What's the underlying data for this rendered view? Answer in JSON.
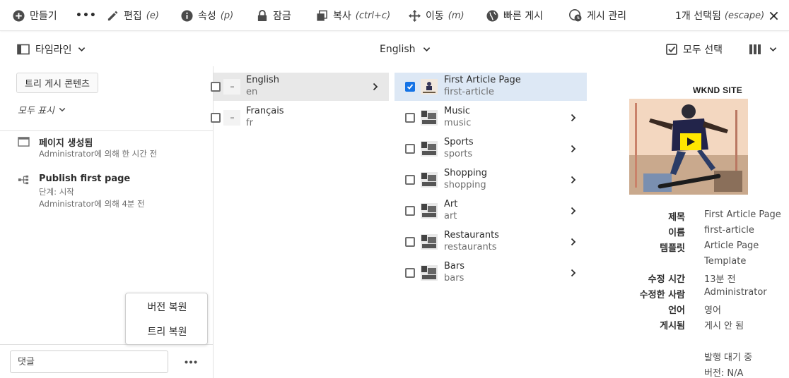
{
  "actionbar": {
    "create": "만들기",
    "more": "•••",
    "edit": "편집",
    "edit_shortcut": "(e)",
    "properties": "속성",
    "properties_shortcut": "(p)",
    "lock": "잠금",
    "copy": "복사",
    "copy_shortcut": "(ctrl+c)",
    "move": "이동",
    "move_shortcut": "(m)",
    "quick_publish": "빠른 게시",
    "manage_publication": "게시 관리",
    "selection_count": "1개 선택됨",
    "selection_shortcut": "(escape)"
  },
  "toolbar2": {
    "rail_selector": "타임라인",
    "language": "English",
    "select_all": "모두 선택"
  },
  "rail": {
    "tree_button": "트리 게시 콘텐츠",
    "filter": "모두 표시",
    "timeline": [
      {
        "title": "페이지 생성됨",
        "lines": [
          "Administrator에 의해 한 시간 전"
        ]
      },
      {
        "title": "Publish first page",
        "lines": [
          "단계: 시작",
          "Administrator에 의해 4분 전"
        ]
      }
    ],
    "popover": {
      "restore_version": "버전 복원",
      "restore_tree": "트리 복원"
    },
    "comment_placeholder": "댓글",
    "more": "•••"
  },
  "column1": {
    "items": [
      {
        "title": "English",
        "name": "en"
      },
      {
        "title": "Français",
        "name": "fr"
      }
    ]
  },
  "column2": {
    "items": [
      {
        "title": "First Article Page",
        "name": "first-article"
      },
      {
        "title": "Music",
        "name": "music"
      },
      {
        "title": "Sports",
        "name": "sports"
      },
      {
        "title": "Shopping",
        "name": "shopping"
      },
      {
        "title": "Art",
        "name": "art"
      },
      {
        "title": "Restaurants",
        "name": "restaurants"
      },
      {
        "title": "Bars",
        "name": "bars"
      }
    ]
  },
  "preview": {
    "brand": "WKND SITE",
    "meta": [
      {
        "label": "제목",
        "value": "First Article Page"
      },
      {
        "label": "이름",
        "value": "first-article"
      },
      {
        "label": "템플릿",
        "value": "Article Page"
      },
      {
        "label": "",
        "value": "Template"
      },
      {
        "label": "수정 시간",
        "value": "13분 전"
      },
      {
        "label": "수정한 사람",
        "value": "Administrator"
      },
      {
        "label": "언어",
        "value": "영어"
      },
      {
        "label": "게시됨",
        "value": "게시 안 됨"
      }
    ],
    "pending": "발행 대기 중",
    "version": "버전: N/A"
  },
  "colors": {
    "accent": "#1473e6",
    "selected_row": "#dde8f5",
    "active_row": "#e8e8e8"
  }
}
